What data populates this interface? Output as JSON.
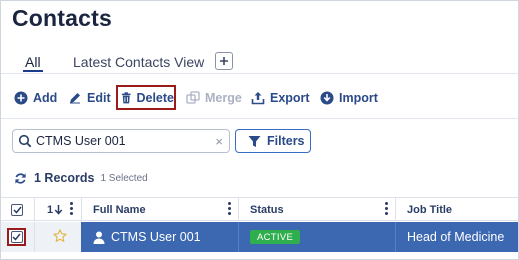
{
  "page": {
    "title": "Contacts"
  },
  "tabs": {
    "all": "All",
    "latest": "Latest Contacts View",
    "add_symbol": "+"
  },
  "toolbar": {
    "add": "Add",
    "edit": "Edit",
    "delete": "Delete",
    "merge": "Merge",
    "export": "Export",
    "import": "Import"
  },
  "search": {
    "value": "CTMS User 001",
    "clear_symbol": "×",
    "filters_label": "Filters"
  },
  "records": {
    "count": "1 Records",
    "selected": "1 Selected"
  },
  "grid": {
    "sort_label": "1",
    "columns": [
      "Full Name",
      "Status",
      "Job Title"
    ],
    "rows": [
      {
        "full_name": "CTMS User 001",
        "status": "ACTIVE",
        "job_title": "Head of Medicine",
        "selected": true,
        "starred": false
      }
    ]
  },
  "colors": {
    "primary": "#2a4a88",
    "highlight_border": "#9b1b1b",
    "selected_row": "#3c68b2",
    "status_active": "#2fae4e"
  }
}
